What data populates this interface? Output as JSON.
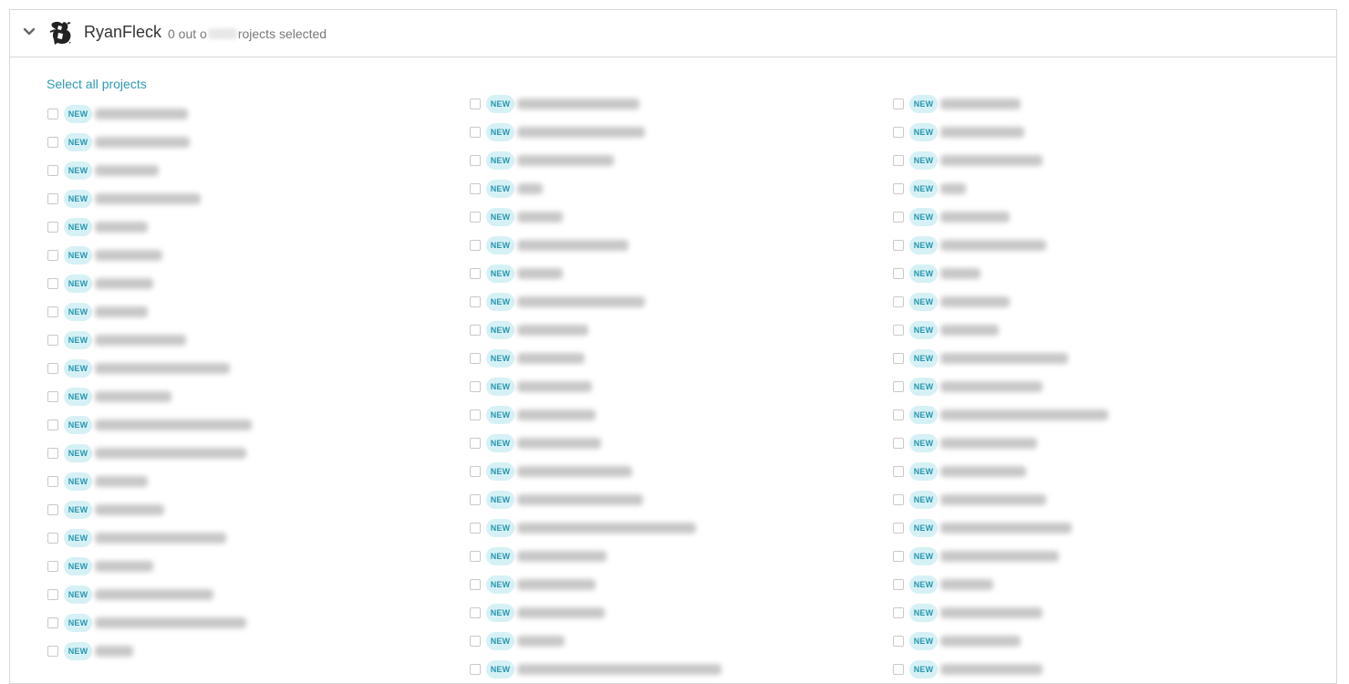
{
  "header": {
    "account_name": "RyanFleck",
    "status_prefix": "0 out o",
    "status_suffix": "rojects selected",
    "chevron_icon": "chevron-down-icon",
    "avatar_icon": "avatar-logo"
  },
  "select_all_label": "Select all projects",
  "badge_label": "NEW",
  "columns": [
    {
      "rows": [
        {
          "name_width": 102
        },
        {
          "name_width": 104
        },
        {
          "name_width": 70
        },
        {
          "name_width": 116
        },
        {
          "name_width": 58
        },
        {
          "name_width": 74
        },
        {
          "name_width": 64
        },
        {
          "name_width": 58
        },
        {
          "name_width": 100
        },
        {
          "name_width": 148
        },
        {
          "name_width": 84
        },
        {
          "name_width": 172
        },
        {
          "name_width": 166
        },
        {
          "name_width": 58
        },
        {
          "name_width": 76
        },
        {
          "name_width": 144
        },
        {
          "name_width": 64
        },
        {
          "name_width": 130
        },
        {
          "name_width": 166
        },
        {
          "name_width": 42
        }
      ]
    },
    {
      "rows": [
        {
          "name_width": 134
        },
        {
          "name_width": 140
        },
        {
          "name_width": 106
        },
        {
          "name_width": 28
        },
        {
          "name_width": 50
        },
        {
          "name_width": 122
        },
        {
          "name_width": 50
        },
        {
          "name_width": 140
        },
        {
          "name_width": 78
        },
        {
          "name_width": 74
        },
        {
          "name_width": 82
        },
        {
          "name_width": 86
        },
        {
          "name_width": 92
        },
        {
          "name_width": 126
        },
        {
          "name_width": 138
        },
        {
          "name_width": 196
        },
        {
          "name_width": 98
        },
        {
          "name_width": 86
        },
        {
          "name_width": 96
        },
        {
          "name_width": 52
        },
        {
          "name_width": 224
        }
      ]
    },
    {
      "rows": [
        {
          "name_width": 88
        },
        {
          "name_width": 92
        },
        {
          "name_width": 112
        },
        {
          "name_width": 28
        },
        {
          "name_width": 76
        },
        {
          "name_width": 116
        },
        {
          "name_width": 44
        },
        {
          "name_width": 76
        },
        {
          "name_width": 64
        },
        {
          "name_width": 140
        },
        {
          "name_width": 112
        },
        {
          "name_width": 184
        },
        {
          "name_width": 106
        },
        {
          "name_width": 94
        },
        {
          "name_width": 116
        },
        {
          "name_width": 144
        },
        {
          "name_width": 130
        },
        {
          "name_width": 58
        },
        {
          "name_width": 112
        },
        {
          "name_width": 88
        },
        {
          "name_width": 112
        }
      ]
    }
  ]
}
